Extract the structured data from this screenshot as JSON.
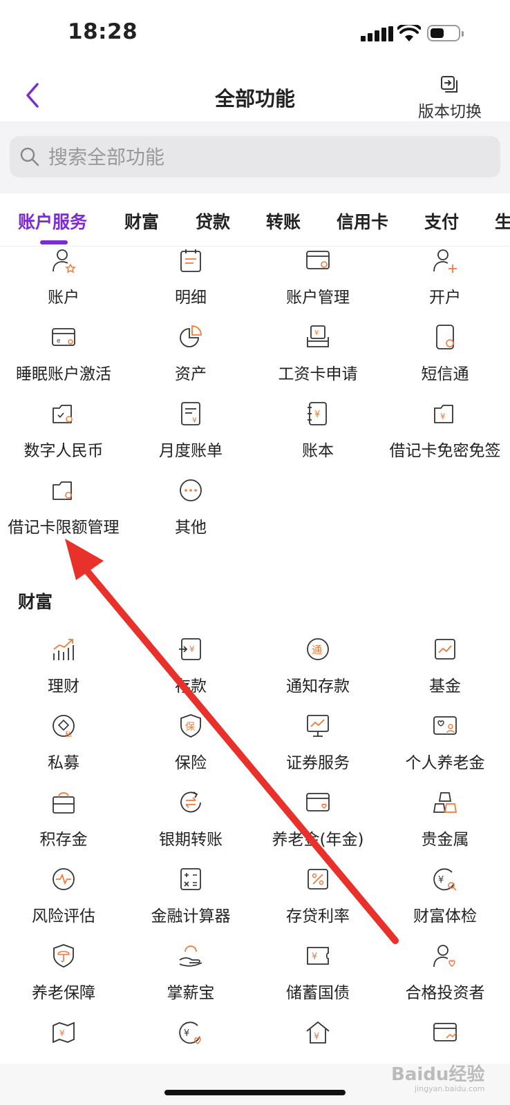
{
  "status_bar": {
    "time": "18:28"
  },
  "header": {
    "title": "全部功能",
    "switch_label": "版本切换"
  },
  "search": {
    "placeholder": "搜索全部功能"
  },
  "tabs": [
    "账户服务",
    "财富",
    "贷款",
    "转账",
    "信用卡",
    "支付",
    "生"
  ],
  "account_items": [
    "账户",
    "明细",
    "账户管理",
    "开户",
    "睡眠账户激活",
    "资产",
    "工资卡申请",
    "短信通",
    "数字人民币",
    "月度账单",
    "账本",
    "借记卡免密免签",
    "借记卡限额管理",
    "其他"
  ],
  "wealth_section": {
    "title": "财富"
  },
  "wealth_items": [
    "理财",
    "存款",
    "通知存款",
    "基金",
    "私募",
    "保险",
    "证券服务",
    "个人养老金",
    "积存金",
    "银期转账",
    "养老金(年金)",
    "贵金属",
    "风险评估",
    "金融计算器",
    "存贷利率",
    "财富体检",
    "养老保障",
    "掌薪宝",
    "储蓄国债",
    "合格投资者"
  ],
  "watermark": {
    "brand": "Baidu经验",
    "url": "jingyan.baidu.com"
  },
  "colors": {
    "accent": "#7b2bd1",
    "icon_orange": "#ef7a3a",
    "annotation_arrow": "#e8312a"
  }
}
